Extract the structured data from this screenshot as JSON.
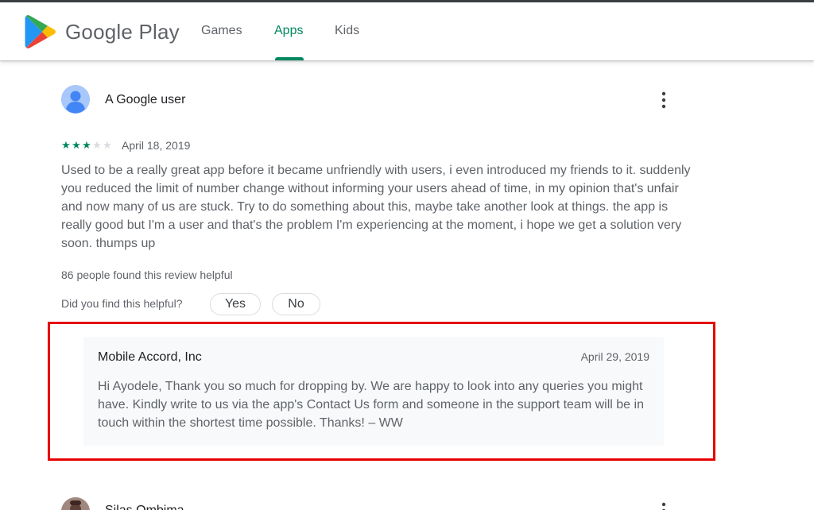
{
  "header": {
    "logo_text": "Google Play",
    "tabs": [
      {
        "label": "Games",
        "active": false
      },
      {
        "label": "Apps",
        "active": true
      },
      {
        "label": "Kids",
        "active": false
      }
    ],
    "accent_color": "#01875f"
  },
  "review": {
    "author": "A Google user",
    "rating": 3,
    "max_rating": 5,
    "stars_display": [
      "★",
      "★",
      "★",
      "★",
      "★"
    ],
    "date": "April 18, 2019",
    "body": "Used to be a really great app before it became unfriendly with users, i even introduced my friends to it. suddenly you reduced the limit of number change without informing your users ahead of time, in my opinion that's unfair and now many of us are stuck. Try to do something about this, maybe take another look at things. the app is really good but I'm a user and that's the problem I'm experiencing at the moment, i hope we get a solution very soon. thumps up",
    "helpful_count_text": "86 people found this review helpful",
    "helpful_question": "Did you find this helpful?",
    "yes_label": "Yes",
    "no_label": "No",
    "developer_reply": {
      "name": "Mobile Accord, Inc",
      "date": "April 29, 2019",
      "text": "Hi Ayodele, Thank you so much for dropping by. We are happy to look into any queries you might have. Kindly write to us via the app's Contact Us form and someone in the support team will be in touch within the shortest time possible. Thanks! – WW"
    }
  },
  "next_review": {
    "author": "Silas Ombima"
  },
  "highlight_color": "#e60000"
}
